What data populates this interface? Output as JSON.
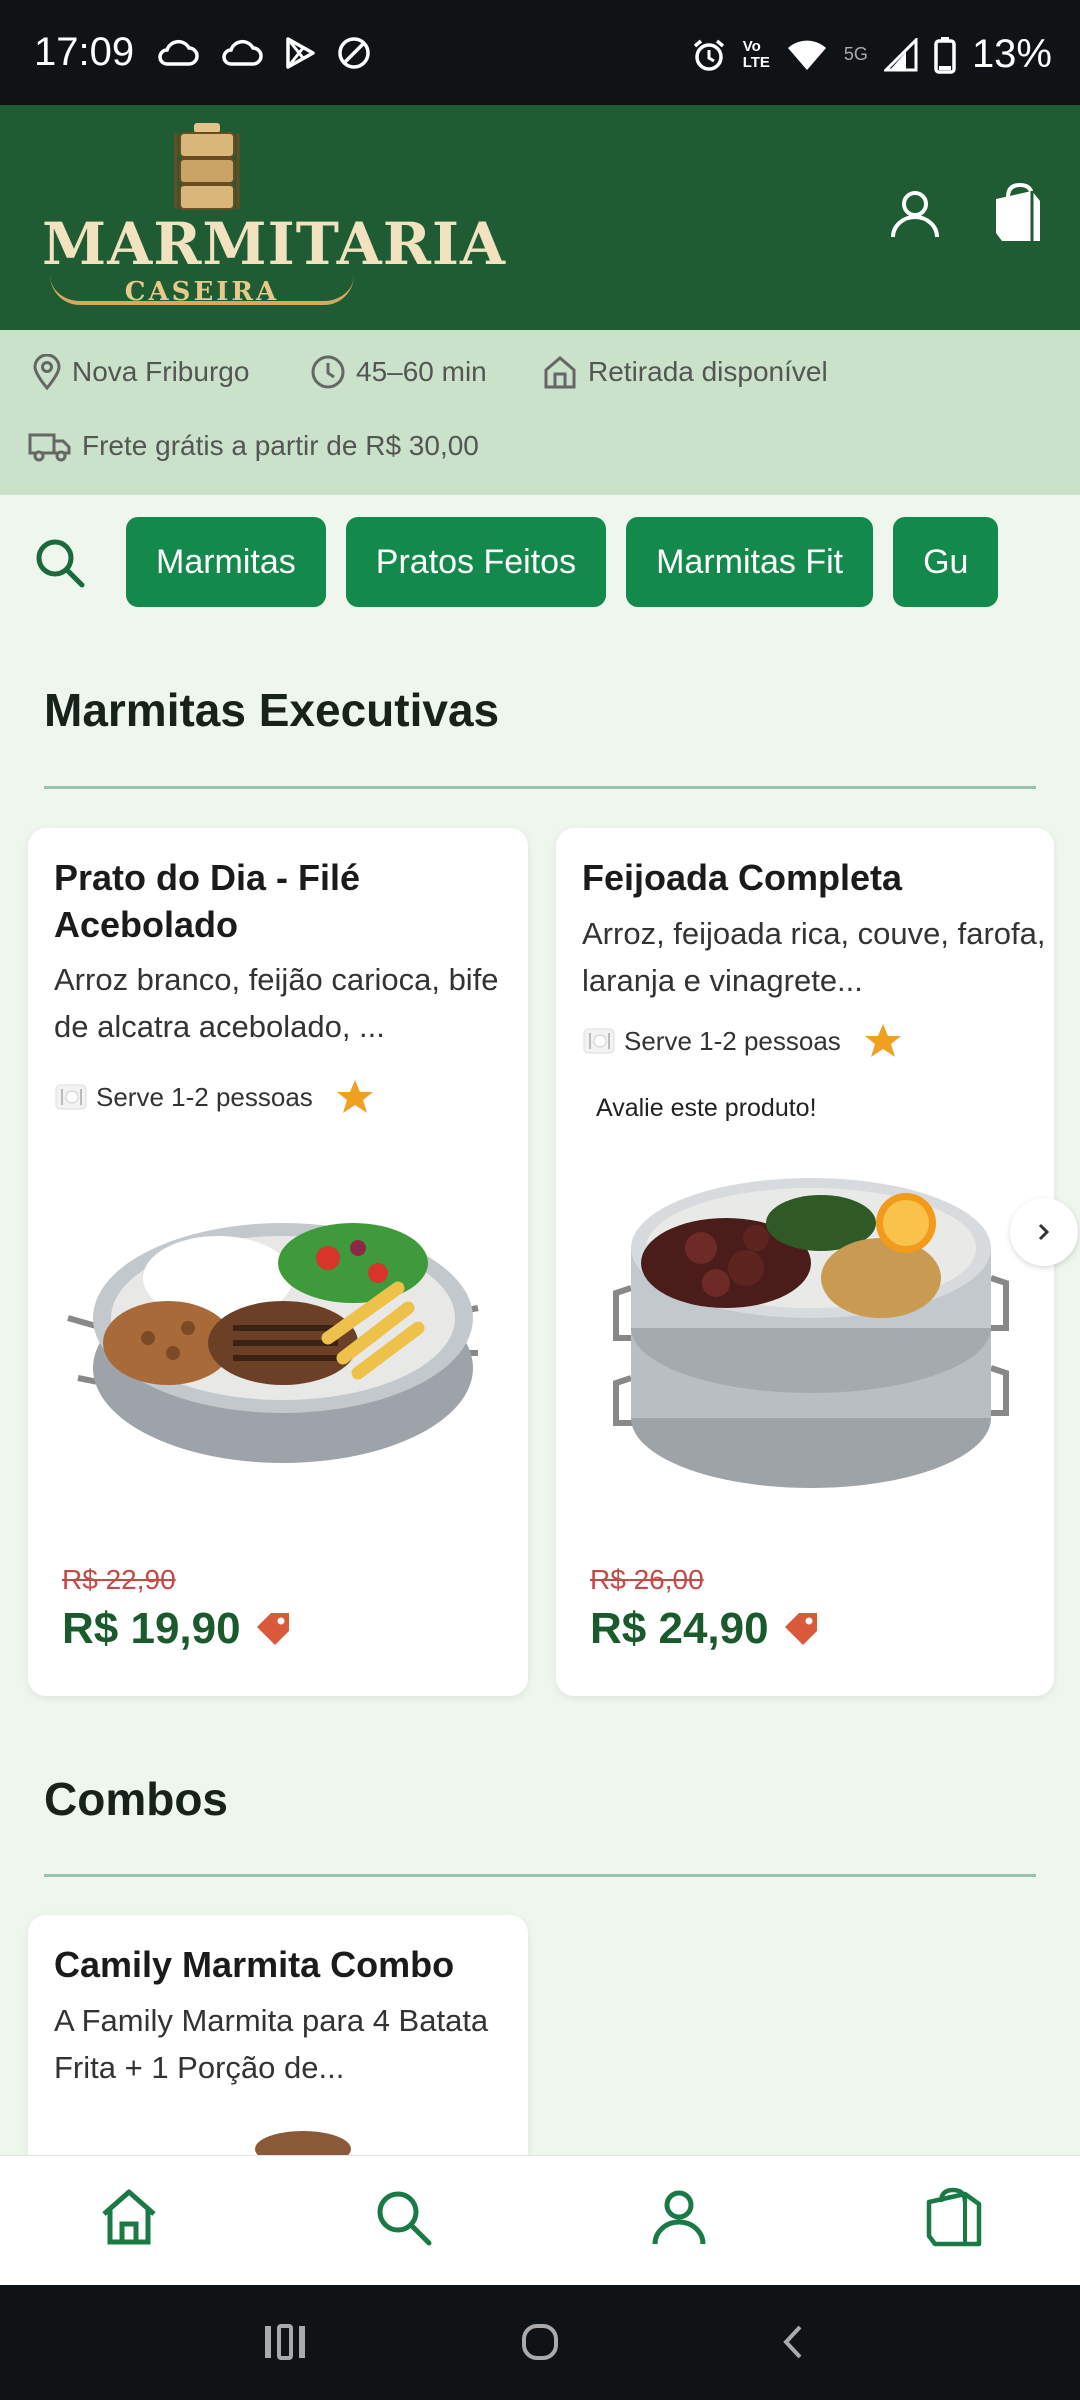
{
  "status_bar": {
    "time": "17:09",
    "battery": "13%",
    "network_label_top": "Vo",
    "network_label_bottom": "LTE",
    "signal_label": "5G",
    "icons": [
      "cloud-icon",
      "cloud-icon",
      "play-store-icon",
      "do-not-disturb-icon",
      "alarm-icon",
      "volte-icon",
      "wifi-icon",
      "signal-icon",
      "battery-icon"
    ]
  },
  "header": {
    "logo_word": "MARMITARIA",
    "logo_sub": "CASEIRA",
    "icons": [
      "user-icon",
      "shopping-bag-icon"
    ]
  },
  "info": {
    "location": "Nova Friburgo",
    "delivery_time": "45–60 min",
    "pickup": "Retirada disponível",
    "shipping": "Frete grátis a partir de R$ 30,00"
  },
  "categories": [
    "Marmitas",
    "Pratos Feitos",
    "Marmitas Fit",
    "Gu"
  ],
  "sections": [
    {
      "title": "Marmitas Executivas",
      "products": [
        {
          "title": "Prato do Dia - Filé Acebolado",
          "description": "Arroz branco, feijão carioca, bife de alcatra acebolado, ...",
          "serves": "Serve 1-2 pessoas",
          "old_price": "R$ 22,90",
          "price": "R$ 19,90"
        },
        {
          "title": "Feijoada Completa",
          "description": "Arroz, feijoada rica, couve, farofa, laranja e vinagrete...",
          "serves": "Serve 1-2 pessoas",
          "review_prompt": "Avalie este produto!",
          "old_price": "R$ 26,00",
          "price": "R$ 24,90"
        }
      ]
    },
    {
      "title": "Combos",
      "products": [
        {
          "title": "Camily Marmita Combo",
          "description": "A Family Marmita para 4 Batata Frita  + 1 Porção de..."
        }
      ]
    }
  ],
  "bottom_nav": [
    "home-icon",
    "search-icon",
    "user-icon",
    "shopping-bag-icon"
  ],
  "colors": {
    "header_green": "#1f5c34",
    "chip_green": "#138a4b",
    "price_green": "#1b5a2c",
    "old_price_red": "#c44a45",
    "star_orange": "#f0a020"
  }
}
